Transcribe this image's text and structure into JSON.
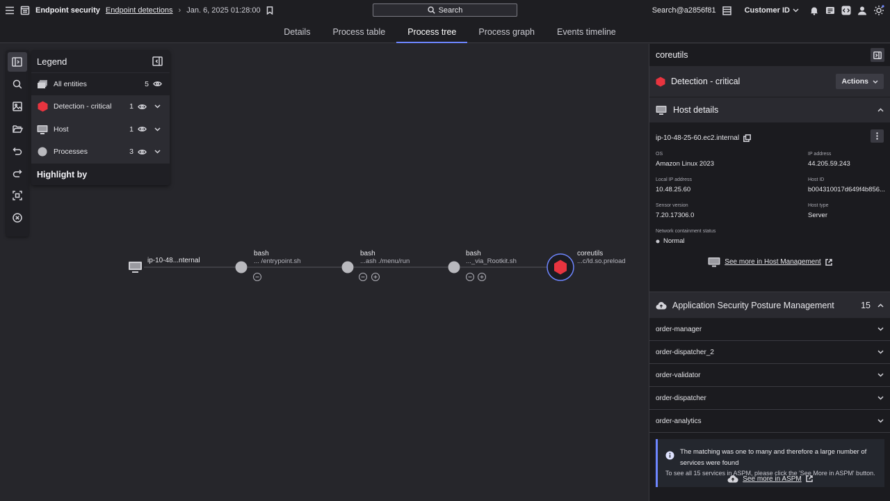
{
  "topbar": {
    "app_name": "Endpoint security",
    "breadcrumb_link": "Endpoint detections",
    "timestamp": "Jan. 6, 2025 01:28:00",
    "search_label": "Search",
    "user": "Search@a2856f81",
    "customer_label": "Customer ID"
  },
  "tabs": [
    {
      "label": "Details"
    },
    {
      "label": "Process table"
    },
    {
      "label": "Process tree",
      "active": true
    },
    {
      "label": "Process graph"
    },
    {
      "label": "Events timeline"
    }
  ],
  "legend": {
    "title": "Legend",
    "rows": [
      {
        "label": "All entities",
        "count": "5"
      },
      {
        "label": "Detection - critical",
        "count": "1"
      },
      {
        "label": "Host",
        "count": "1"
      },
      {
        "label": "Processes",
        "count": "3"
      }
    ],
    "highlight_label": "Highlight by"
  },
  "graph": {
    "host": {
      "label": "ip-10-48...nternal"
    },
    "nodes": [
      {
        "name": "bash",
        "sub": "... /entrypoint.sh"
      },
      {
        "name": "bash",
        "sub": "...ash ./menu/run"
      },
      {
        "name": "bash",
        "sub": "..._via_Rootkit.sh"
      },
      {
        "name": "coreutils",
        "sub": "...c/ld.so.preload"
      }
    ]
  },
  "panel": {
    "title": "coreutils",
    "detection_title": "Detection - critical",
    "actions_label": "Actions",
    "host_section_title": "Host details",
    "hostname": "ip-10-48-25-60.ec2.internal",
    "fields": {
      "os": {
        "key": "OS",
        "value": "Amazon Linux 2023"
      },
      "ip": {
        "key": "IP address",
        "value": "44.205.59.243"
      },
      "local_ip": {
        "key": "Local IP address",
        "value": "10.48.25.60"
      },
      "host_id": {
        "key": "Host ID",
        "value": "b004310017d649f4b856..."
      },
      "sensor": {
        "key": "Sensor version",
        "value": "7.20.17306.0"
      },
      "host_type": {
        "key": "Host type",
        "value": "Server"
      },
      "containment": {
        "key": "Network containment status",
        "value": "Normal"
      }
    },
    "host_see_more": "See more in Host Management",
    "aspm_title": "Application Security Posture Management",
    "aspm_count": "15",
    "services": [
      "order-manager",
      "order-dispatcher_2",
      "order-validator",
      "order-dispatcher",
      "order-analytics"
    ],
    "info_message": "The matching was one to many and therefore a large number of services were found",
    "info_sub": "To see all 15 services in ASPM, please click the 'See More in ASPM' button.",
    "aspm_see_more": "See more in ASPM"
  },
  "colors": {
    "accent": "#6e86ff",
    "critical": "#e8343f",
    "process": "#b9b9be"
  }
}
